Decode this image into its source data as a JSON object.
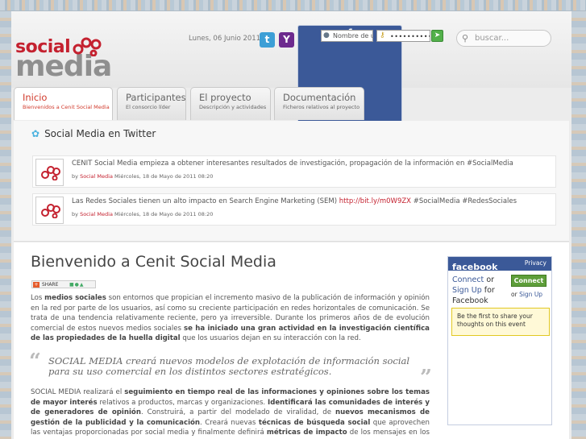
{
  "header": {
    "logo_top": "social",
    "logo_bottom": "media",
    "date": "Lunes, 06 Junio 2011",
    "social_icons": [
      "twitter-icon",
      "yahoo-icon",
      "facebook-icon"
    ],
    "username_placeholder": "Nombre de u",
    "password_mask": "••••••••••••",
    "search_placeholder": "buscar..."
  },
  "tabs": [
    {
      "label": "Inicio",
      "sub": "Bienvenidos a Cenit Social Media",
      "active": true
    },
    {
      "label": "Participantes",
      "sub": "El consorcio líder",
      "active": false
    },
    {
      "label": "El proyecto",
      "sub": "Descripción y actividades",
      "active": false
    },
    {
      "label": "Documentación",
      "sub": "Ficheros relativos al proyecto",
      "active": false
    }
  ],
  "twitter": {
    "title": "Social Media en Twitter",
    "tweets": [
      {
        "text": "CENIT Social Media empieza a obtener interesantes resultados de investigación, propagación de la información en #SocialMedia",
        "link": "",
        "text_after": "",
        "by": "by",
        "author": "Social Media",
        "date": "Miércoles, 18 de Mayo de 2011 08:20"
      },
      {
        "text": "Las Redes Sociales tienen un alto impacto en Search Engine Marketing (SEM) ",
        "link": "http://bit.ly/m0W9ZX",
        "text_after": " #SocialMedia #RedesSociales",
        "by": "by",
        "author": "Social Media",
        "date": "Miércoles, 18 de Mayo de 2011 08:20"
      }
    ]
  },
  "main": {
    "title": "Bienvenido a Cenit Social Media",
    "share_label": "SHARE",
    "p1": [
      {
        "t": "Los ",
        "b": false
      },
      {
        "t": "medios sociales",
        "b": true
      },
      {
        "t": " son entornos que propician el incremento masivo de la publicación de información y opinión en la red por parte de los usuarios, así como su creciente participación en redes horizontales de comunicación. Se trata de una tendencia relativamente reciente, pero ya irreversible. Durante los primeros años de de evolución comercial de estos nuevos medios sociales ",
        "b": false
      },
      {
        "t": "se ha iniciado una gran actividad en la investigación científica de las propiedades de la huella digital",
        "b": true
      },
      {
        "t": " que los usuarios dejan en su interacción con la red.",
        "b": false
      }
    ],
    "quote": "SOCIAL MEDIA creará nuevos modelos de explotación de información social para su uso comercial en los distintos sectores estratégicos.",
    "p2": [
      {
        "t": "SOCIAL MEDIA realizará el ",
        "b": false
      },
      {
        "t": "seguimiento en tiempo real de las informaciones y opiniones sobre los temas de mayor interés",
        "b": true
      },
      {
        "t": " relativos a productos, marcas y organizaciones. ",
        "b": false
      },
      {
        "t": "Identificará las comunidades de interés y de generadores de opinión",
        "b": true
      },
      {
        "t": ". Construirá, a partir del modelado de viralidad, de ",
        "b": false
      },
      {
        "t": "nuevos mecanismos de gestión de la publicidad y la comunicación",
        "b": true
      },
      {
        "t": ". Creará nuevas ",
        "b": false
      },
      {
        "t": "técnicas de búsqueda social",
        "b": true
      },
      {
        "t": " que aprovechen las ventajas proporcionadas por social media y finalmente definirá ",
        "b": false
      },
      {
        "t": "métricas de impacto",
        "b": true
      },
      {
        "t": " de los mensajes en los consumidores que dependan del objetivo comercial y del grupo social al que se dirigen.",
        "b": false
      }
    ]
  },
  "facebook": {
    "brand": "facebook",
    "privacy": "Privacy",
    "connect_link": "Connect",
    "or": "or",
    "signup_link": "Sign Up",
    "for_facebook": "for Facebook",
    "connect_button": "Connect",
    "or_small": "or",
    "signup_small": "Sign Up",
    "note": "Be the first to share your thoughts on this event"
  },
  "colors": {
    "brand_red": "#c4212f",
    "facebook_blue": "#3b5998",
    "connect_green": "#5e9e3a"
  }
}
